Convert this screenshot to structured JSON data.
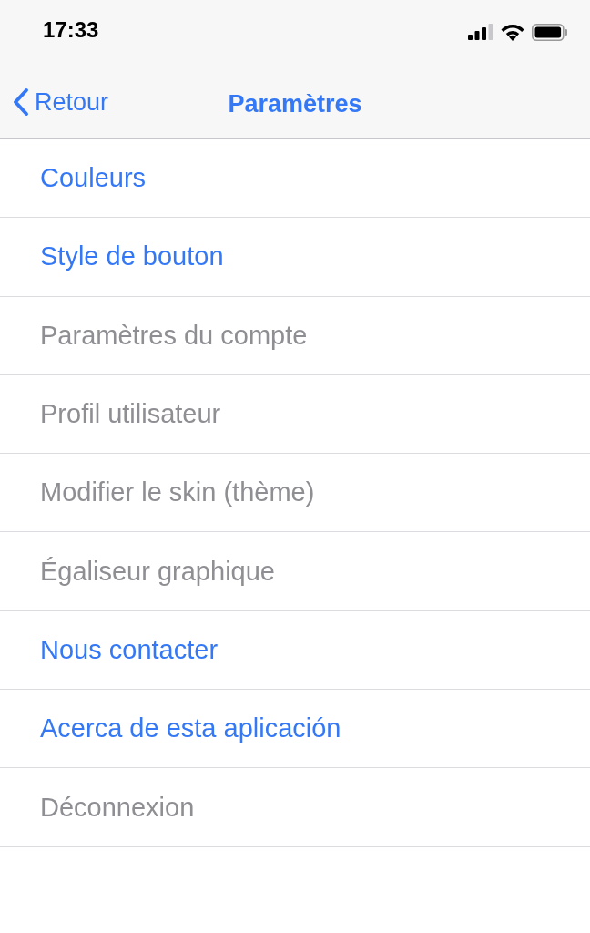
{
  "status_bar": {
    "time": "17:33"
  },
  "nav_bar": {
    "back": "Retour",
    "title": "Paramètres"
  },
  "items": [
    {
      "label": "Couleurs",
      "disabled": false
    },
    {
      "label": "Style de bouton",
      "disabled": false
    },
    {
      "label": "Paramètres du compte",
      "disabled": true
    },
    {
      "label": "Profil utilisateur",
      "disabled": true
    },
    {
      "label": "Modifier le skin (thème)",
      "disabled": true
    },
    {
      "label": "Égaliseur graphique",
      "disabled": true
    },
    {
      "label": "Nous contacter",
      "disabled": false
    },
    {
      "label": "Acerca de esta aplicación",
      "disabled": false
    },
    {
      "label": "Déconnexion",
      "disabled": true
    }
  ]
}
